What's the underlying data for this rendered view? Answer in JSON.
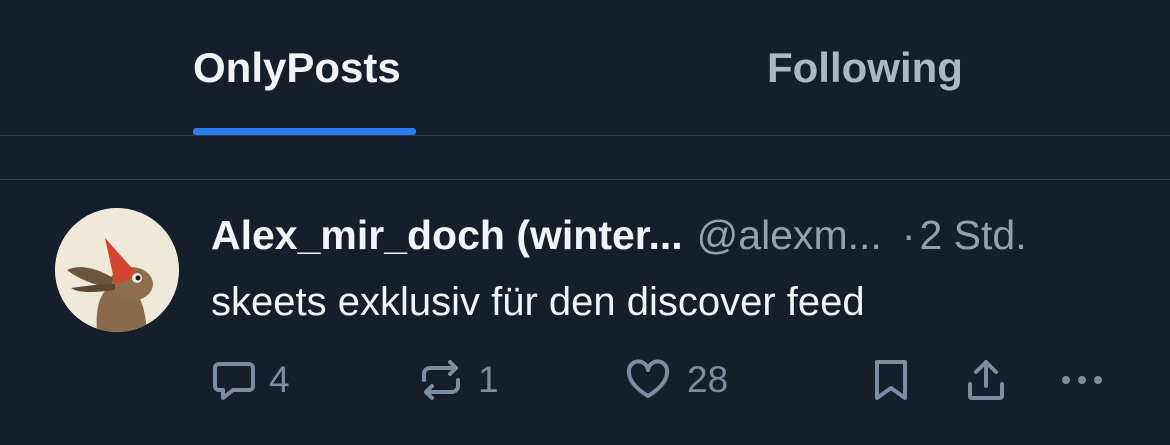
{
  "tabs": [
    {
      "label": "OnlyPosts",
      "active": true
    },
    {
      "label": "Following",
      "active": false
    }
  ],
  "post": {
    "author_display": "Alex_mir_doch (winter...",
    "author_handle": "@alexm...",
    "separator": "·",
    "time": "2 Std.",
    "text": "skeets exklusiv für den discover feed",
    "actions": {
      "reply_count": "4",
      "repost_count": "1",
      "like_count": "28"
    }
  },
  "icons": [
    "reply-icon",
    "repost-icon",
    "heart-icon",
    "bookmark-icon",
    "share-icon",
    "more-icon"
  ],
  "colors": {
    "background": "#161e2b",
    "active_tab_underline": "#2a7cf0",
    "muted_text": "#93a0b2",
    "icon": "#7d8ca2"
  }
}
